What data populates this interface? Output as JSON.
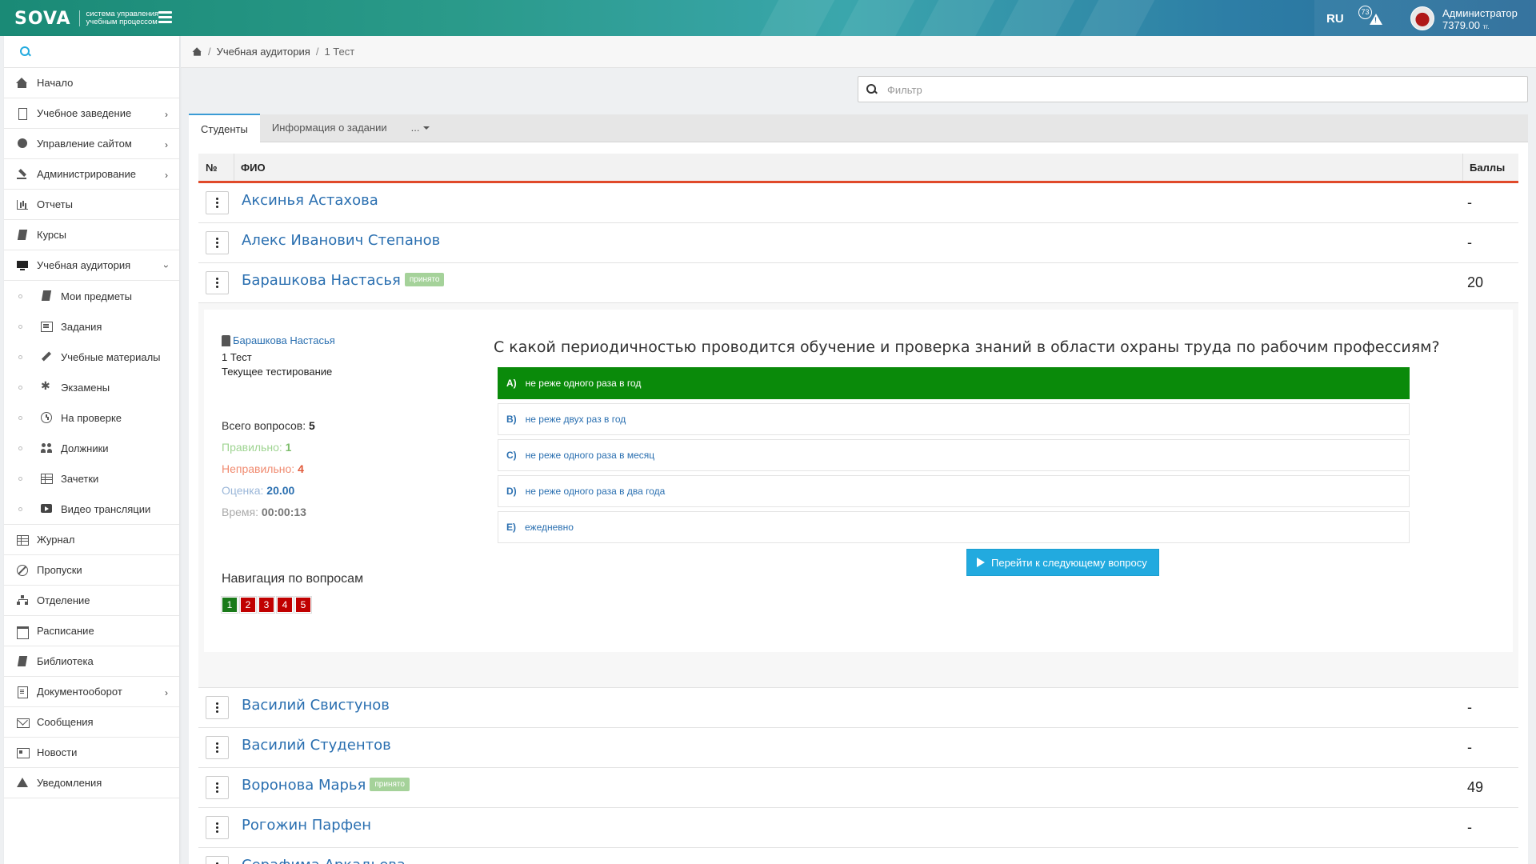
{
  "header": {
    "brand": "SOVA",
    "tagline": "система управления\nучебным процессом",
    "lang": "RU",
    "alert_count": "73",
    "user_name": "Администратор",
    "user_balance": "7379.00",
    "currency": "тг."
  },
  "sidebar": {
    "search_placeholder": "",
    "items": [
      {
        "label": "Начало",
        "icon": "home-icon"
      },
      {
        "label": "Учебное заведение",
        "icon": "building-icon",
        "has_children": true
      },
      {
        "label": "Управление сайтом",
        "icon": "globe-icon",
        "has_children": true
      },
      {
        "label": "Администрирование",
        "icon": "gavel-icon",
        "has_children": true
      },
      {
        "label": "Отчеты",
        "icon": "bar-chart-icon"
      },
      {
        "label": "Курсы",
        "icon": "book-icon"
      },
      {
        "label": "Учебная аудитория",
        "icon": "monitor-icon",
        "expanded": true
      }
    ],
    "sub_items": [
      {
        "label": "Мои предметы",
        "icon": "book-icon"
      },
      {
        "label": "Задания",
        "icon": "list-icon"
      },
      {
        "label": "Учебные материалы",
        "icon": "pencil-icon"
      },
      {
        "label": "Экзамены",
        "icon": "asterisk-icon"
      },
      {
        "label": "На проверке",
        "icon": "clock-icon"
      },
      {
        "label": "Должники",
        "icon": "users-icon"
      },
      {
        "label": "Зачетки",
        "icon": "table-icon"
      },
      {
        "label": "Видео трансляции",
        "icon": "video-icon"
      }
    ],
    "items_after": [
      {
        "label": "Журнал",
        "icon": "table-icon"
      },
      {
        "label": "Пропуски",
        "icon": "ban-icon"
      },
      {
        "label": "Отделение",
        "icon": "sitemap-icon"
      },
      {
        "label": "Расписание",
        "icon": "calendar-icon"
      },
      {
        "label": "Библиотека",
        "icon": "book-icon"
      },
      {
        "label": "Документооборот",
        "icon": "document-icon",
        "has_children": true
      },
      {
        "label": "Сообщения",
        "icon": "envelope-icon"
      },
      {
        "label": "Новости",
        "icon": "newspaper-icon"
      },
      {
        "label": "Уведомления",
        "icon": "warning-icon"
      }
    ]
  },
  "breadcrumb": {
    "items": [
      "Учебная аудитория",
      "1 Тест"
    ]
  },
  "filter": {
    "placeholder": "Фильтр"
  },
  "tabs": [
    {
      "label": "Студенты",
      "active": true
    },
    {
      "label": "Информация о задании"
    },
    {
      "label": "..."
    }
  ],
  "grid": {
    "col_num": "№",
    "col_fio": "ФИО",
    "col_score": "Баллы",
    "rows_before": [
      {
        "name": "Аксинья Астахова",
        "score": "-",
        "badge": ""
      },
      {
        "name": "Алекс Иванович Степанов",
        "score": "-",
        "badge": ""
      },
      {
        "name": "Барашкова Настасья",
        "score": "20",
        "badge": "принято"
      }
    ],
    "rows_after": [
      {
        "name": "Василий Свистунов",
        "score": "-",
        "badge": ""
      },
      {
        "name": "Василий Студентов",
        "score": "-",
        "badge": ""
      },
      {
        "name": "Воронова Марья",
        "score": "49",
        "badge": "принято"
      },
      {
        "name": "Рогожин Парфен",
        "score": "-",
        "badge": ""
      },
      {
        "name": "Серафима Аркадьева",
        "score": "",
        "badge": ""
      }
    ]
  },
  "detail": {
    "student_link": "Барашкова Настасья",
    "test_name": "1 Тест",
    "test_status": "Текущее тестирование",
    "stats": {
      "total_label": "Всего вопросов:",
      "total_value": "5",
      "correct_label": "Правильно:",
      "correct_value": "1",
      "wrong_label": "Неправильно:",
      "wrong_value": "4",
      "grade_label": "Оценка:",
      "grade_value": "20.00",
      "time_label": "Время:",
      "time_value": "00:00:13"
    },
    "nav_title": "Навигация по вопросам",
    "nav": [
      {
        "n": "1",
        "status": "correct",
        "color": "#1a7a1a"
      },
      {
        "n": "2",
        "status": "wrong",
        "color": "#c00000"
      },
      {
        "n": "3",
        "status": "wrong",
        "color": "#c00000"
      },
      {
        "n": "4",
        "status": "wrong",
        "color": "#c00000"
      },
      {
        "n": "5",
        "status": "wrong",
        "color": "#c00000"
      }
    ],
    "question": "С какой периодичностью проводится обучение и проверка знаний в области охраны труда по рабочим профессиям?",
    "options": [
      {
        "letter": "A)",
        "text": "не реже одного раза в год",
        "selected": true
      },
      {
        "letter": "B)",
        "text": "не реже двух раз в год"
      },
      {
        "letter": "C)",
        "text": "не реже одного раза в месяц"
      },
      {
        "letter": "D)",
        "text": "не реже одного раза в два года"
      },
      {
        "letter": "E)",
        "text": "ежедневно"
      }
    ],
    "next_button": "Перейти к следующему вопросу"
  },
  "colors": {
    "accent": "#3a9bd5",
    "selected_option": "#0a8a0a",
    "header_underline": "#e04a2a",
    "next_button": "#22aadf"
  }
}
